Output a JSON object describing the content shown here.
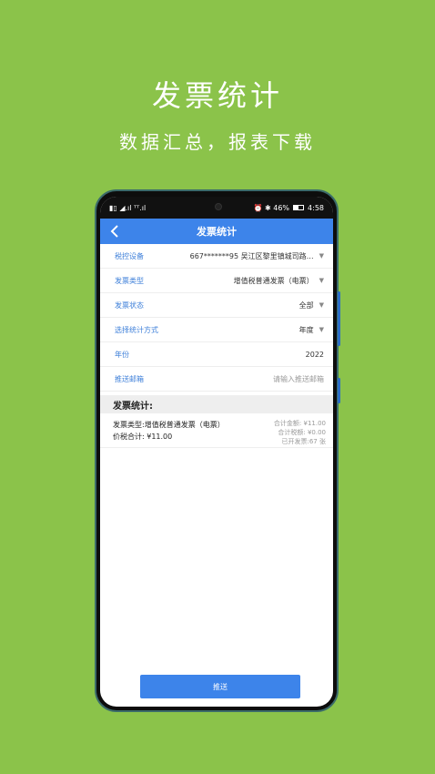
{
  "promo": {
    "title": "发票统计",
    "subtitle": "数据汇总，报表下载"
  },
  "status_bar": {
    "left": "▮▯ ◢.ıl ᵀᵀ.ıl",
    "right_icons": "⏰ ✱ 46%",
    "time": "4:58"
  },
  "header": {
    "title": "发票统计"
  },
  "form": {
    "rows": [
      {
        "label": "税控设备",
        "value": "667*******95 吴江区黎里镇城司路…",
        "dropdown": true
      },
      {
        "label": "发票类型",
        "value": "增值税普通发票（电票）",
        "dropdown": true
      },
      {
        "label": "发票状态",
        "value": "全部",
        "dropdown": true
      },
      {
        "label": "选择统计方式",
        "value": "年度",
        "dropdown": true
      },
      {
        "label": "年份",
        "value": "2022",
        "dropdown": false
      },
      {
        "label": "推送邮箱",
        "value": "",
        "placeholder": "请输入推送邮箱",
        "dropdown": false
      }
    ]
  },
  "stats": {
    "section_title": "发票统计:",
    "invoice_type": "发票类型:增值税普通发票（电票）",
    "total_with_tax": "价税合计: ¥11.00",
    "total_amount": "合计金额: ¥11.00",
    "total_tax": "合计税额: ¥0.00",
    "issued_count": "已开发票:67 张"
  },
  "submit": {
    "label": "推送"
  },
  "colors": {
    "background": "#8bc34a",
    "accent": "#3d84ea",
    "label": "#3d7fd9"
  }
}
